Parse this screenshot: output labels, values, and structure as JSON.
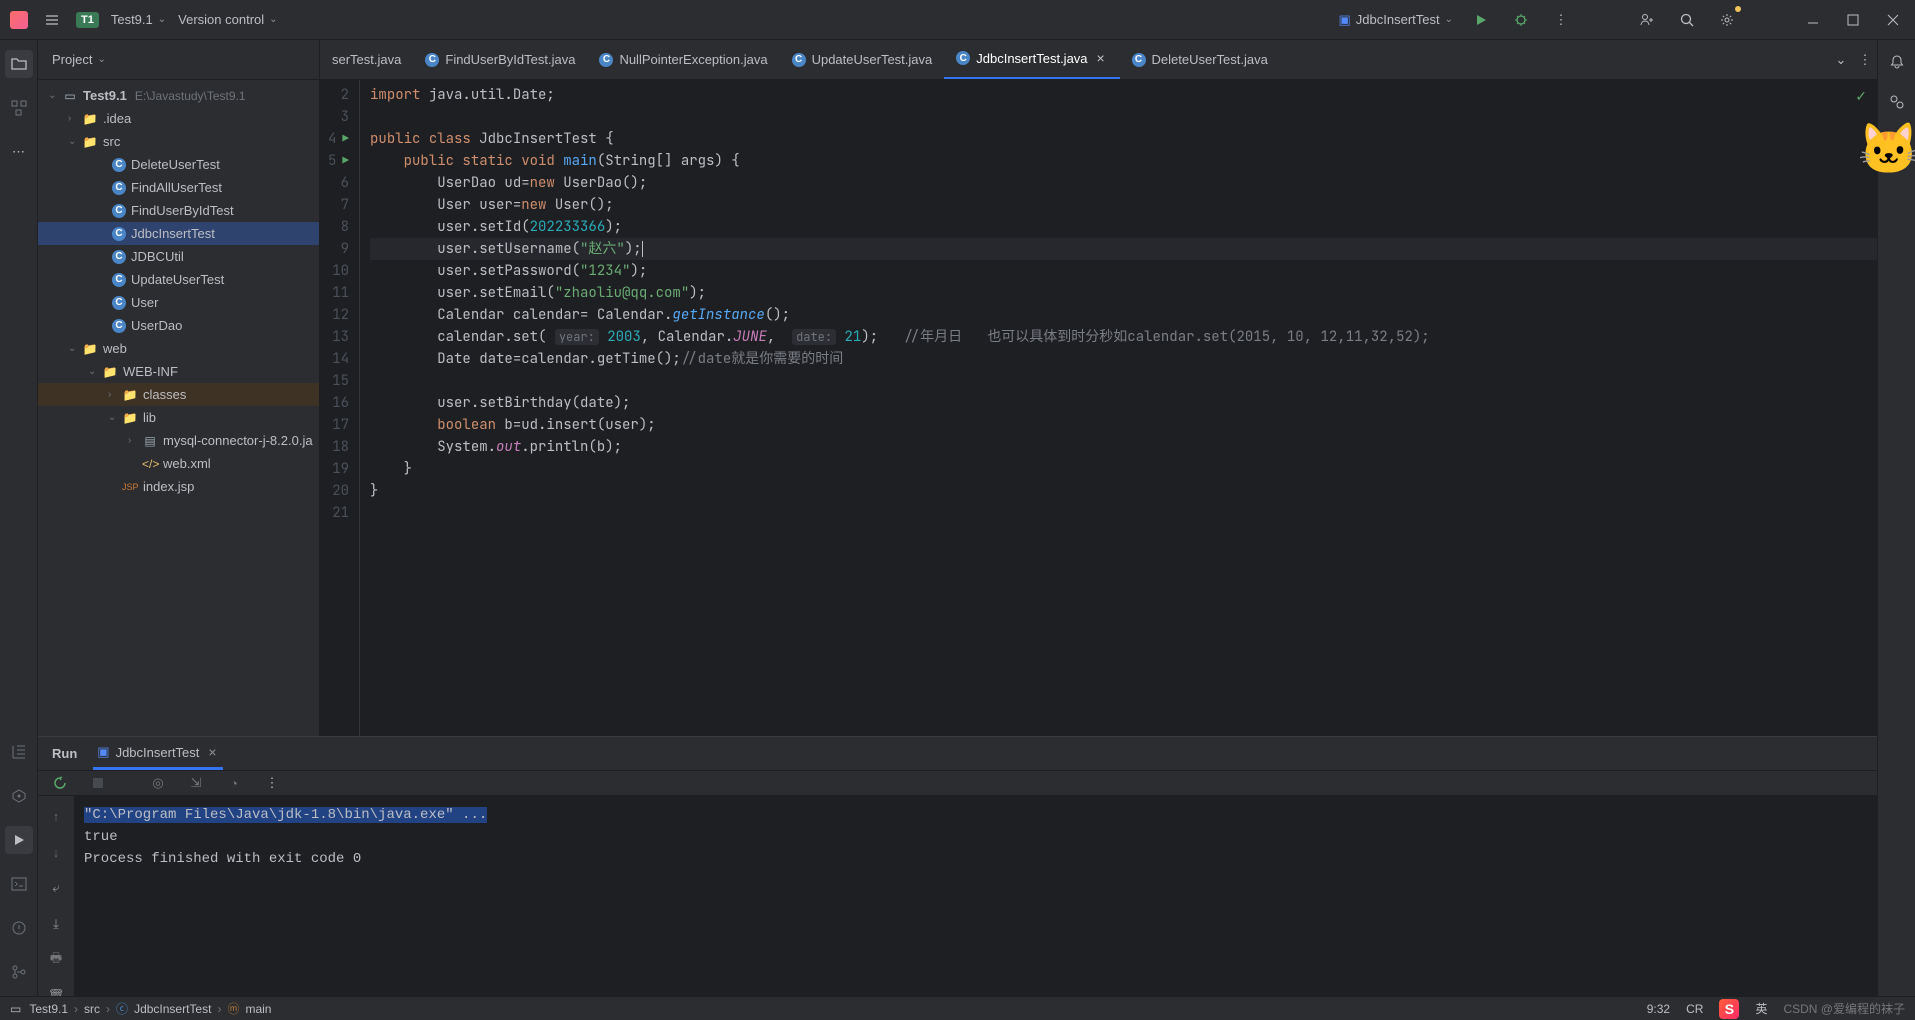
{
  "titlebar": {
    "projectBadge": "T1",
    "projectName": "Test9.1",
    "vcs": "Version control",
    "runConfig": "JdbcInsertTest"
  },
  "projectTool": {
    "title": "Project"
  },
  "tree": {
    "root": "Test9.1",
    "rootPath": "E:\\Javastudy\\Test9.1",
    "idea": ".idea",
    "src": "src",
    "files": {
      "deleteUser": "DeleteUserTest",
      "findAll": "FindAllUserTest",
      "findById": "FindUserByIdTest",
      "jdbcInsert": "JdbcInsertTest",
      "jdbcUtil": "JDBCUtil",
      "updateUser": "UpdateUserTest",
      "user": "User",
      "userDao": "UserDao"
    },
    "web": "web",
    "webinf": "WEB-INF",
    "classes": "classes",
    "lib": "lib",
    "mysql": "mysql-connector-j-8.2.0.ja",
    "webxml": "web.xml",
    "indexjsp": "index.jsp"
  },
  "tabs": {
    "t1": "serTest.java",
    "t2": "FindUserByIdTest.java",
    "t3": "NullPointerException.java",
    "t4": "UpdateUserTest.java",
    "t5": "JdbcInsertTest.java",
    "t6": "DeleteUserTest.java"
  },
  "code": {
    "ln2": "import java.util.Date;",
    "className": "JdbcInsertTest",
    "mainName": "main",
    "mainArgs": "(String[] args) {",
    "l6_a": "UserDao ud=",
    "l6_b": "new",
    "l6_c": " UserDao();",
    "l7_a": "User user=",
    "l7_b": "new",
    "l7_c": " User();",
    "l8_a": "user.setId(",
    "l8_num": "202233366",
    "l8_b": ");",
    "l9_a": "user.setUsername(",
    "l9_str": "\"赵六\"",
    "l9_b": ");",
    "l10_a": "user.setPassword(",
    "l10_str": "\"1234\"",
    "l10_b": ");",
    "l11_a": "user.setEmail(",
    "l11_str": "\"zhaoliu@qq.com\"",
    "l11_b": ");",
    "l12_a": "Calendar calendar= Calendar.",
    "l12_fn": "getInstance",
    "l12_b": "();",
    "l13_a": "calendar.set( ",
    "l13_h1": "year:",
    "l13_n1": "2003",
    "l13_b": ", Calendar.",
    "l13_const": "JUNE",
    "l13_c": ",  ",
    "l13_h2": "date:",
    "l13_n2": "21",
    "l13_d": ");   ",
    "l13_cmt": "//年月日   也可以具体到时分秒如calendar.set(2015, 10, 12,11,32,52);",
    "l14_a": "Date date=calendar.getTime();",
    "l14_cmt": "//date就是你需要的时间",
    "l16": "user.setBirthday(date);",
    "l17_a": "boolean",
    "l17_b": " b=ud.insert(user);",
    "l18_a": "System.",
    "l18_out": "out",
    "l18_b": ".println(b);"
  },
  "run": {
    "tab": "Run",
    "config": "JdbcInsertTest"
  },
  "console": {
    "l1": "\"C:\\Program Files\\Java\\jdk-1.8\\bin\\java.exe\" ...",
    "l2": "true",
    "l4": "Process finished with exit code 0"
  },
  "breadcrumb": {
    "b1": "Test9.1",
    "b2": "src",
    "b3": "JdbcInsertTest",
    "b4": "main"
  },
  "status": {
    "cursor": "9:32",
    "encoding": "CR",
    "ime": "英",
    "watermark": "CSDN @爱编程的袜子"
  }
}
